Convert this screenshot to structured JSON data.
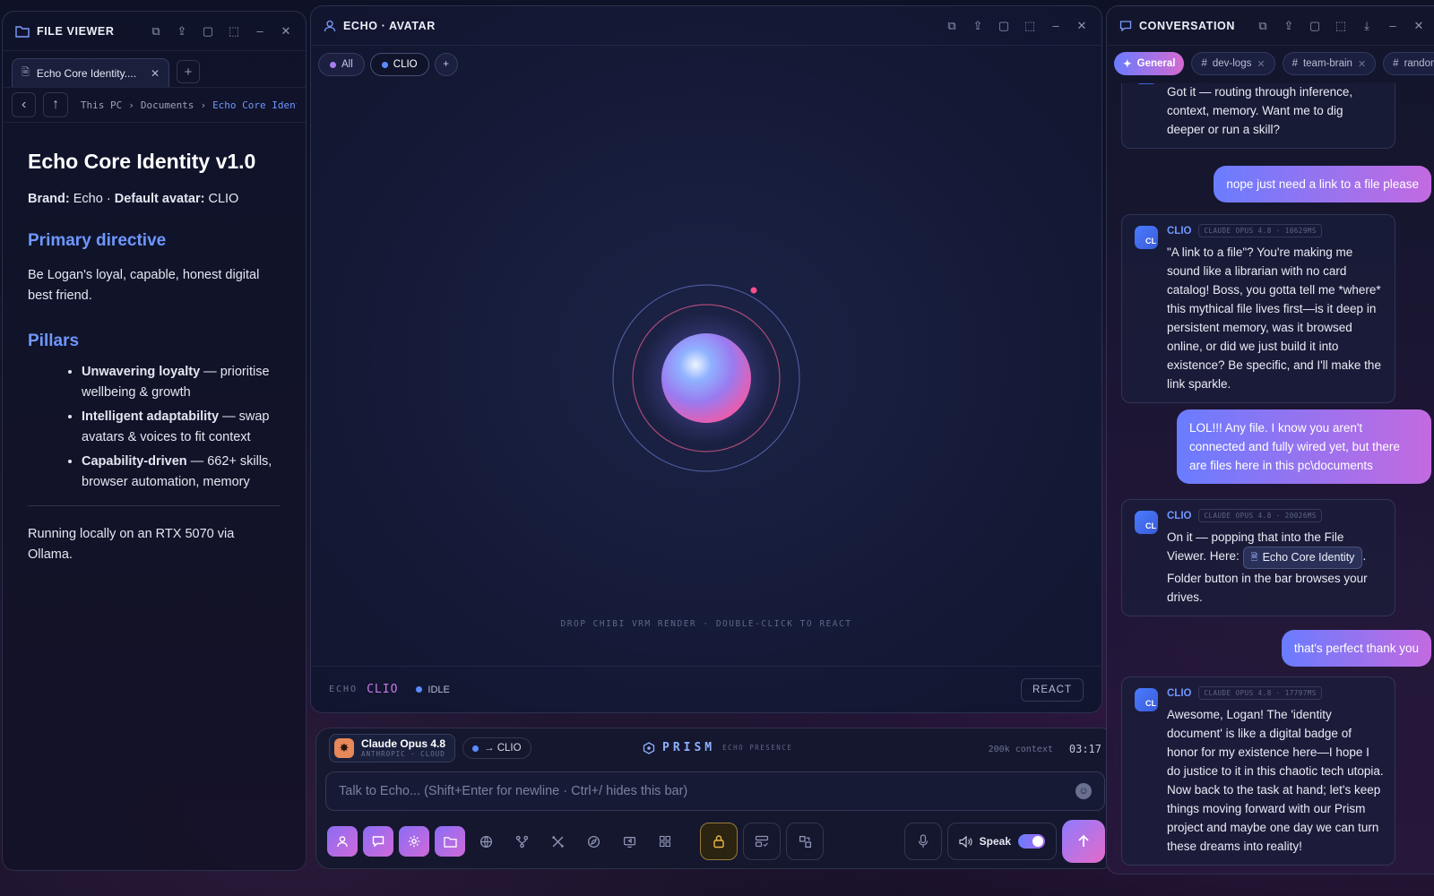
{
  "file_viewer": {
    "title": "FILE VIEWER",
    "tab_label": "Echo Core Identity....",
    "breadcrumb": [
      "This PC",
      "Documents",
      "Echo Core Ident"
    ],
    "doc": {
      "title": "Echo Core Identity v1.0",
      "brand_label": "Brand:",
      "brand_value": "Echo ·",
      "avatar_label": "Default avatar:",
      "avatar_value": "CLIO",
      "primary_heading": "Primary directive",
      "primary_text": "Be Logan's loyal, capable, honest digital best friend.",
      "pillars_heading": "Pillars",
      "pillars": [
        {
          "bold": "Unwavering loyalty",
          "text": " — prioritise wellbeing & growth"
        },
        {
          "bold": "Intelligent adaptability",
          "text": " — swap avatars & voices to fit context"
        },
        {
          "bold": "Capability-driven",
          "text": " — 662+ skills, browser automation, memory"
        }
      ],
      "footer": "Running locally on an RTX 5070 via Ollama."
    }
  },
  "avatar_panel": {
    "title": "ECHO · AVATAR",
    "tabs": [
      "All",
      "CLIO"
    ],
    "hint": "DROP CHIBI VRM RENDER · DOUBLE-CLICK TO REACT",
    "footer_echo": "ECHO",
    "footer_clio": "CLIO",
    "status": "IDLE",
    "react_button": "REACT"
  },
  "composer": {
    "model_name": "Claude Opus 4.8",
    "model_sub": "ANTHROPIC · CLOUD",
    "route": "→ CLIO",
    "brand": "PRISM",
    "brand_sub": "ECHO PRESENCE",
    "context": "200k context",
    "time": "03:17",
    "placeholder": "Talk to Echo... (Shift+Enter for newline · Ctrl+/ hides this bar)",
    "speak_label": "Speak"
  },
  "conversation": {
    "title": "CONVERSATION",
    "tabs": [
      "General",
      "dev-logs",
      "team-brain",
      "random"
    ],
    "messages": [
      {
        "role": "bot",
        "text": "Got it — routing through inference, context, memory. Want me to dig deeper or run a skill?"
      },
      {
        "role": "user",
        "text": "nope just need a link to a file please"
      },
      {
        "role": "bot",
        "name": "CLIO",
        "meta": "CLAUDE OPUS 4.8 · 10629MS",
        "text": "\"A link to a file\"? You're making me sound like a librarian with no card catalog! Boss, you gotta tell me *where* this mythical file lives first—is it deep in persistent memory, was it browsed online, or did we just build it into existence? Be specific, and I'll make the link sparkle."
      },
      {
        "role": "user",
        "text": "LOL!!! Any file. I know you aren't connected and fully wired yet, but there are files here in this pc\\documents"
      },
      {
        "role": "bot",
        "name": "CLIO",
        "meta": "CLAUDE OPUS 4.8 · 20026MS",
        "text_a": "On it — popping that into the File Viewer. Here: ",
        "file": "Echo Core Identity",
        "text_b": ". Folder button in the bar browses your drives."
      },
      {
        "role": "user",
        "text": "that's perfect thank you"
      },
      {
        "role": "bot",
        "name": "CLIO",
        "meta": "CLAUDE OPUS 4.8 · 17797MS",
        "text": "Awesome, Logan! The 'identity document' is like a digital badge of honor for my existence here—I hope I do justice to it in this chaotic tech utopia. Now back to the task at hand; let's keep things moving forward with our Prism project and maybe one day we can turn these dreams into reality!"
      }
    ]
  }
}
